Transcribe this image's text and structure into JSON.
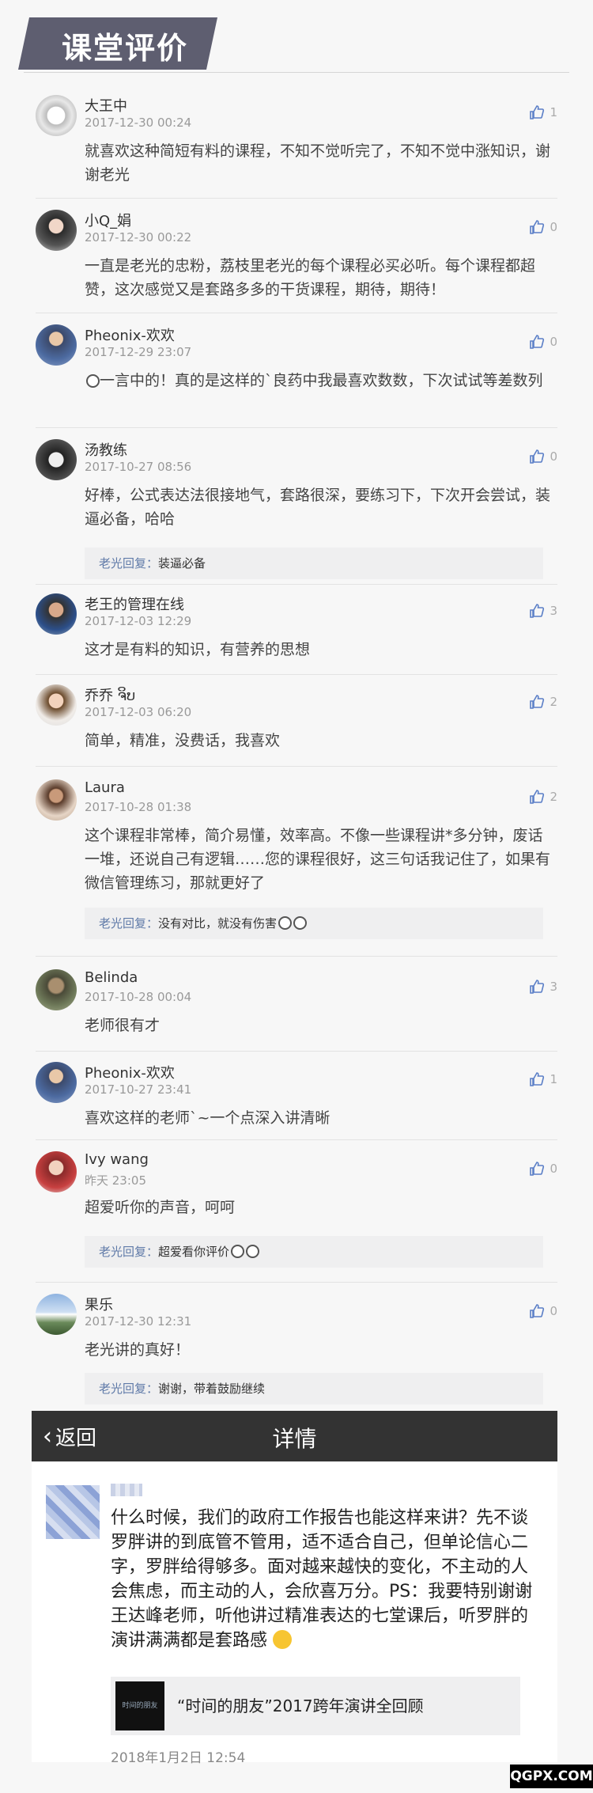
{
  "header": {
    "title": "课堂评价"
  },
  "comments": [
    {
      "name": "大王中",
      "time": "2017-12-30 00:24",
      "text": "就喜欢这种简短有料的课程，不知不觉听完了，不知不觉中涨知识，谢谢老光",
      "likes": "1"
    },
    {
      "name": "小Q_娟",
      "time": "2017-12-30 00:22",
      "text": "一直是老光的忠粉，荔枝里老光的每个课程必买必听。每个课程都超赞，这次感觉又是套路多多的干货课程，期待，期待！",
      "likes": "0"
    },
    {
      "name": "Pheonix-欢欢",
      "time": "2017-12-29 23:07",
      "text": "一言中的！真的是这样的`良药中我最喜欢数数，下次试试等差数列",
      "likes": "0"
    },
    {
      "name": "汤教练",
      "time": "2017-10-27 08:56",
      "text": "好棒，公式表达法很接地气，套路很深，要练习下，下次开会尝试，装逼必备，哈哈",
      "likes": "0",
      "reply_name": "老光回复：",
      "reply_text": "装逼必备"
    },
    {
      "name": "老王的管理在线",
      "time": "2017-12-03 12:29",
      "text": "这才是有料的知识，有营养的思想",
      "likes": "3"
    },
    {
      "name": "乔乔 ຈິບ",
      "time": "2017-12-03 06:20",
      "text": "简单，精准，没费话，我喜欢",
      "likes": "2"
    },
    {
      "name": "Laura",
      "time": "2017-10-28 01:38",
      "text": "这个课程非常棒，简介易懂，效率高。不像一些课程讲*多分钟，废话一堆，还说自己有逻辑……您的课程很好，这三句话我记住了，如果有微信管理练习，那就更好了",
      "likes": "2",
      "reply_name": "老光回复：",
      "reply_text": "没有对比，就没有伤害"
    },
    {
      "name": "Belinda",
      "time": "2017-10-28 00:04",
      "text": "老师很有才",
      "likes": "3"
    },
    {
      "name": "Pheonix-欢欢",
      "time": "2017-10-27 23:41",
      "text": "喜欢这样的老师`~一个点深入讲清晰",
      "likes": "1"
    },
    {
      "name": "Ivy wang",
      "time": "昨天 23:05",
      "text": "超爱听你的声音，呵呵",
      "likes": "0",
      "reply_name": "老光回复：",
      "reply_text": "超爱看你评价"
    },
    {
      "name": "果乐",
      "time": "2017-12-30 12:31",
      "text": "老光讲的真好！",
      "likes": "0",
      "reply_name": "老光回复：",
      "reply_text": "谢谢，带着鼓励继续"
    }
  ],
  "nav": {
    "back": "返回",
    "title": "详情"
  },
  "post": {
    "text": "什么时候，我们的政府工作报告也能这样来讲？先不谈罗胖讲的到底管不管用，适不适合自己，但单论信心二字，罗胖给得够多。面对越来越快的变化，不主动的人会焦虑，而主动的人，会欣喜万分。PS：我要特别谢谢王达峰老师，听他讲过精准表达的七堂课后，听罗胖的演讲满满都是套路感",
    "link_title": "“时间的朋友”2017跨年演讲全回顾",
    "link_thumb": "时间的朋友",
    "date": "2018年1月2日 12:54"
  },
  "watermark": "QGPX.COM",
  "colors": {
    "header_bg": "#5e5e70",
    "reply_name": "#5f7aa8",
    "nav_bg": "#333333",
    "like_icon": "#5b7fc7"
  }
}
